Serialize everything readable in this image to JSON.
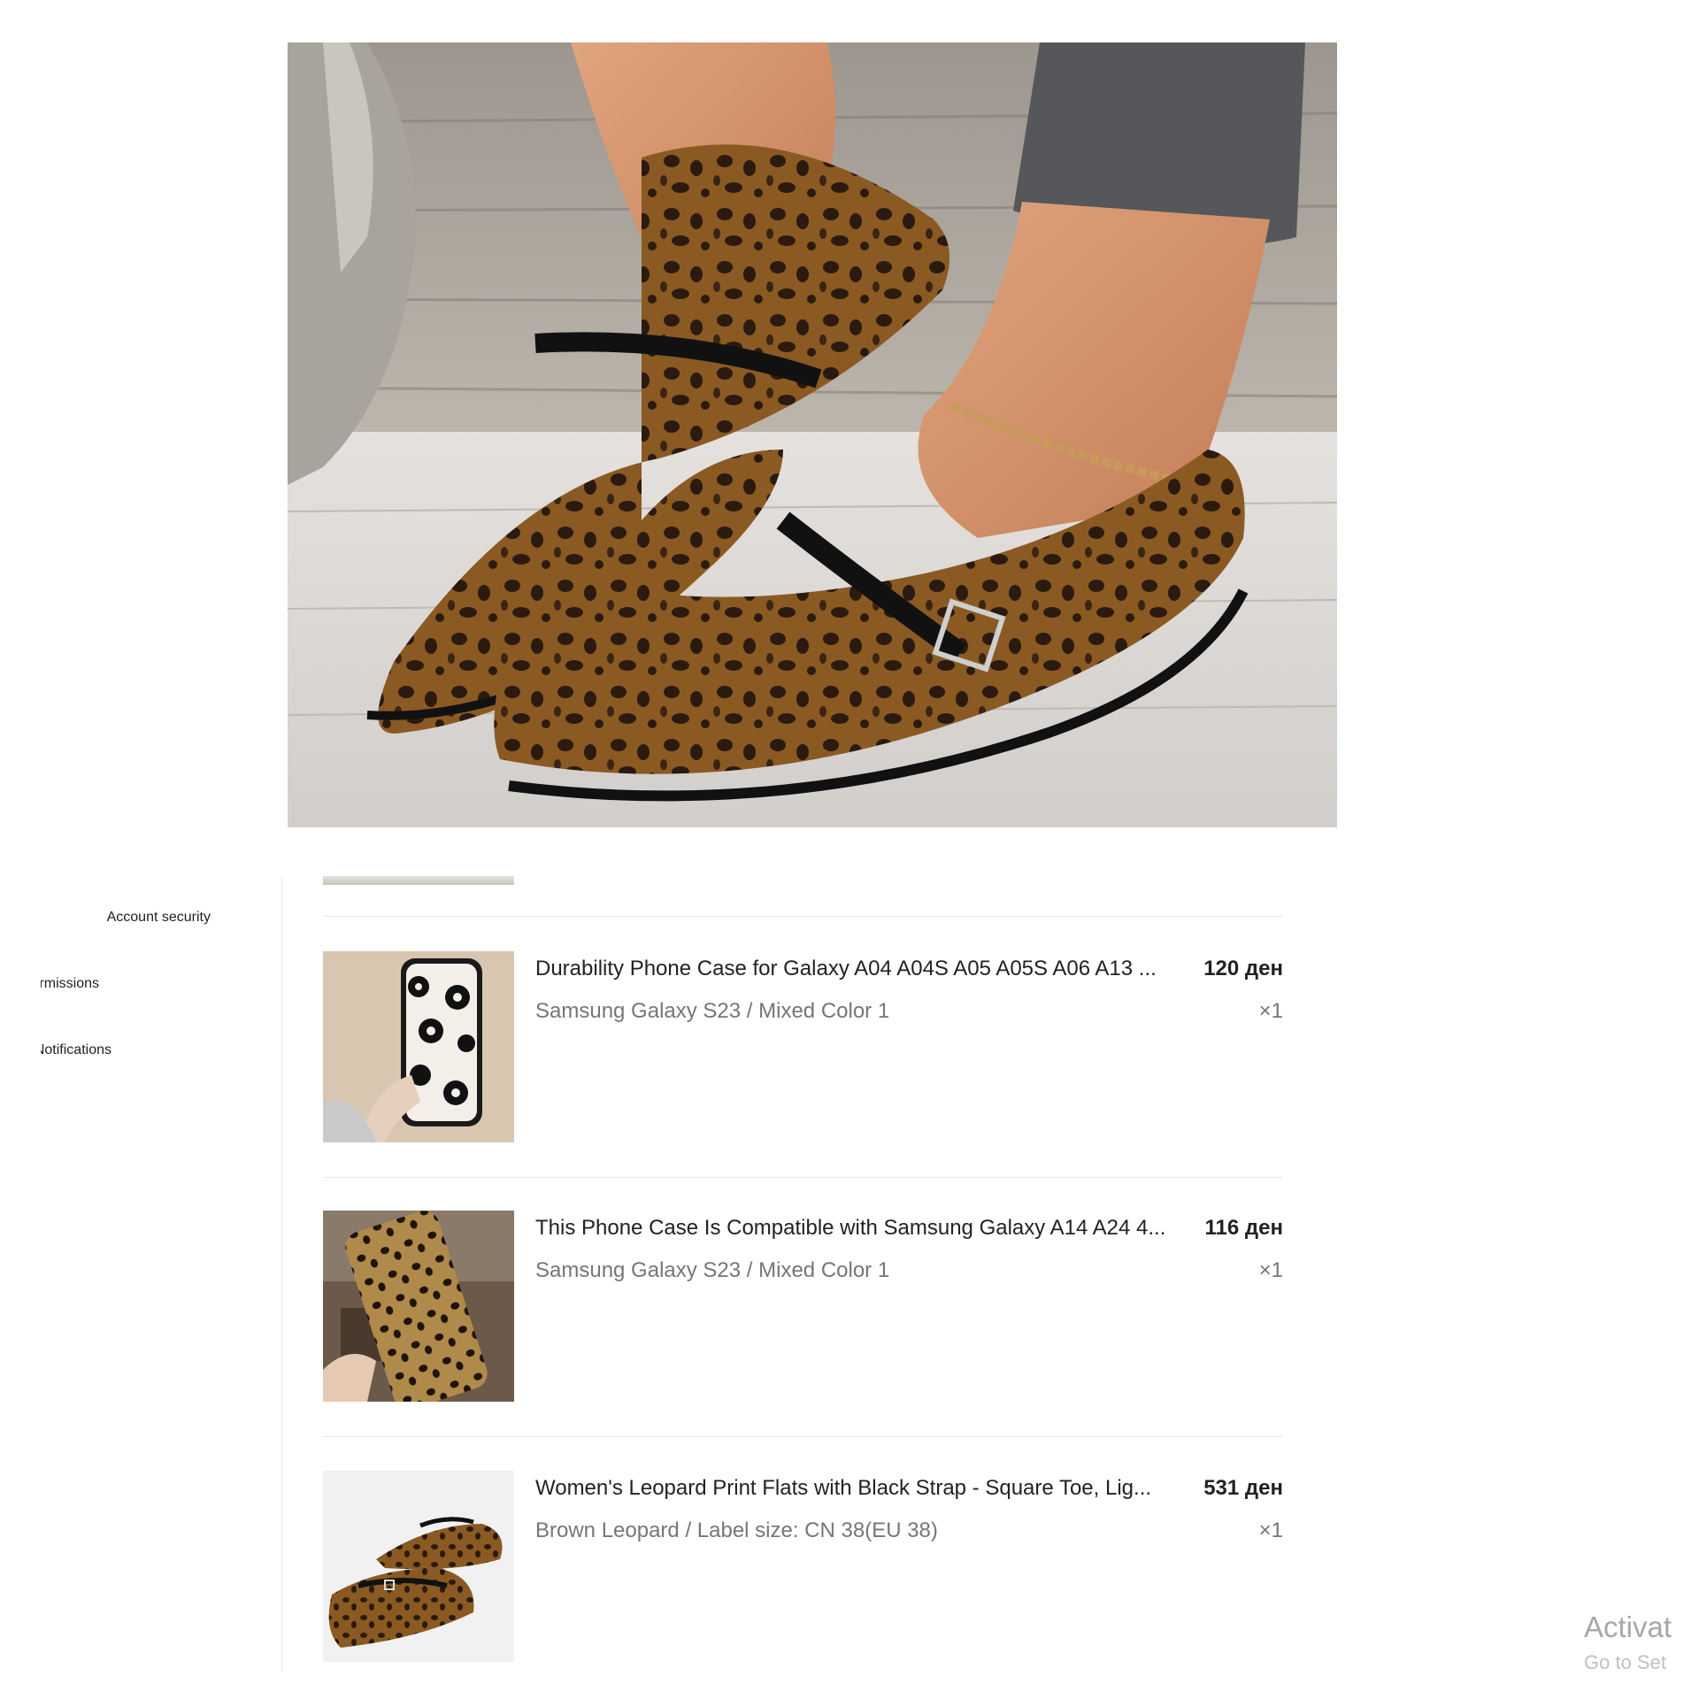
{
  "hero": {
    "image_alt": "Women's leopard print flats with black strap"
  },
  "sidebar": {
    "items": [
      {
        "label": "Account security"
      },
      {
        "label": "Permissions"
      },
      {
        "label": "Notifications"
      }
    ]
  },
  "orders": {
    "items": [
      {
        "title": "Durability Phone Case for Galaxy A04 A04S A05 A05S A06 A13 ...",
        "price": "120 ден",
        "variant": "Samsung Galaxy S23 / Mixed Color 1",
        "qty": "×1"
      },
      {
        "title": "This Phone Case Is Compatible with Samsung Galaxy A14 A24 4...",
        "price": "116 ден",
        "variant": "Samsung Galaxy S23 / Mixed Color 1",
        "qty": "×1"
      },
      {
        "title": "Women's Leopard Print Flats with Black Strap - Square Toe, Lig...",
        "price": "531 ден",
        "variant": "Brown Leopard / Label size: CN 38(EU 38)",
        "qty": "×1"
      }
    ]
  },
  "watermark": {
    "line1": "Activat",
    "line2": "Go to Set"
  },
  "colors": {
    "text_primary": "#222222",
    "text_secondary": "#767676",
    "divider": "#e8e8e8",
    "leopard_base": "#8a5a22",
    "leopard_spot": "#2b1a10"
  }
}
